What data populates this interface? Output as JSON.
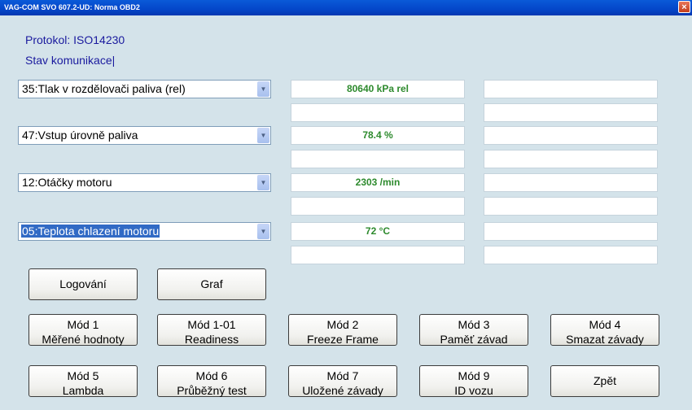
{
  "window": {
    "title": "VAG-COM SVO 607.2-UD:  Norma OBD2",
    "close_label": "×"
  },
  "status": {
    "protocol": "Protokol: ISO14230",
    "comm": "Stav komunikace|"
  },
  "channels": [
    {
      "label": "35:Tlak v rozdělovači paliva (rel)",
      "value": "80640 kPa rel",
      "selected": false
    },
    {
      "label": "47:Vstup úrovně paliva",
      "value": "78.4 %",
      "selected": false
    },
    {
      "label": "12:Otáčky motoru",
      "value": "2303 /min",
      "selected": false
    },
    {
      "label": "05:Teplota chlazení motoru",
      "value": "72 °C",
      "selected": true
    }
  ],
  "dropdown_arrow": "▼",
  "buttons": {
    "logging": "Logování",
    "graph": "Graf",
    "mode1": [
      "Mód 1",
      "Měřené hodnoty"
    ],
    "mode1_01": [
      "Mód 1-01",
      "Readiness"
    ],
    "mode2": [
      "Mód 2",
      "Freeze Frame"
    ],
    "mode3": [
      "Mód 3",
      "Paměť závad"
    ],
    "mode4": [
      "Mód 4",
      "Smazat závady"
    ],
    "mode5": [
      "Mód 5",
      "Lambda"
    ],
    "mode6": [
      "Mód 6",
      "Průběžný test"
    ],
    "mode7": [
      "Mód 7",
      "Uložené závady"
    ],
    "mode9": [
      "Mód 9",
      "ID vozu"
    ],
    "back": "Zpět"
  },
  "colors": {
    "value_text": "#2d8a2d",
    "status_text": "#1a1a9e",
    "selection": "#316ac5",
    "background": "#d4e3ea"
  }
}
